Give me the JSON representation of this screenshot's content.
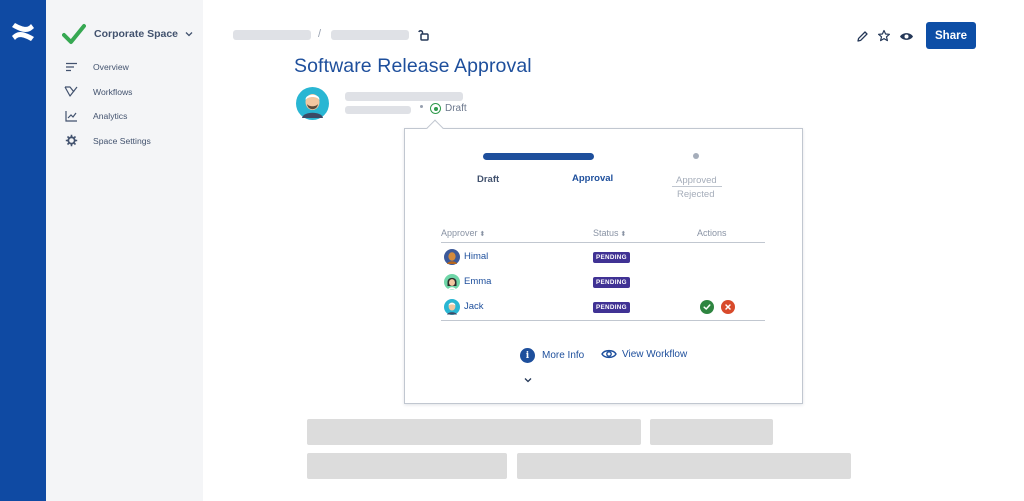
{
  "sidebar": {
    "space_name": "Corporate Space",
    "items": [
      {
        "label": "Overview",
        "icon": "lines-icon"
      },
      {
        "label": "Workflows",
        "icon": "workflow-icon"
      },
      {
        "label": "Analytics",
        "icon": "chart-icon"
      },
      {
        "label": "Space Settings",
        "icon": "gear-icon"
      }
    ]
  },
  "header": {
    "share_label": "Share",
    "breadcrumb_separator": "/"
  },
  "page": {
    "title": "Software Release Approval",
    "status": "Draft"
  },
  "workflow": {
    "stages": {
      "draft": "Draft",
      "approval": "Approval",
      "approved": "Approved",
      "rejected": "Rejected"
    },
    "columns": {
      "approver": "Approver",
      "status": "Status",
      "actions": "Actions",
      "sort_glyph": "⬍"
    },
    "approvers": [
      {
        "name": "Himal",
        "status": "PENDING"
      },
      {
        "name": "Emma",
        "status": "PENDING"
      },
      {
        "name": "Jack",
        "status": "PENDING"
      }
    ],
    "more_info_label": "More Info",
    "info_glyph": "i",
    "view_workflow_label": "View Workflow"
  },
  "colors": {
    "rail": "#0f4aa3",
    "accent": "#1e4f9c",
    "share_button": "#0d4ea6",
    "pending_badge": "#403294",
    "approve": "#2e8540",
    "reject": "#d84a2b",
    "draft_status": "#2f9a4c"
  }
}
